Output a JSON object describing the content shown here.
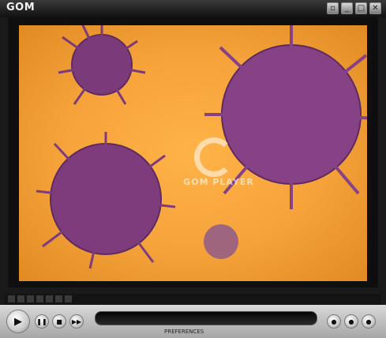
{
  "app": {
    "logo_text": "GOM",
    "watermark_text": "GOM PLAYER"
  },
  "window_buttons": [
    {
      "name": "mini",
      "glyph": "▫"
    },
    {
      "name": "minimize",
      "glyph": "_"
    },
    {
      "name": "maximize",
      "glyph": "□"
    },
    {
      "name": "close",
      "glyph": "✕"
    }
  ],
  "controls": {
    "play_glyph": "▶",
    "pause_glyph": "❚❚",
    "stop_glyph": "■",
    "next_glyph": "▶▶",
    "preferences_label": "PREFERENCES",
    "seek_progress": 0
  },
  "colors": {
    "video_background": "#f5a23a",
    "virus": "#7b3a7a"
  },
  "icons": [
    "play-icon",
    "pause-icon",
    "stop-icon",
    "next-icon",
    "open-icon"
  ]
}
